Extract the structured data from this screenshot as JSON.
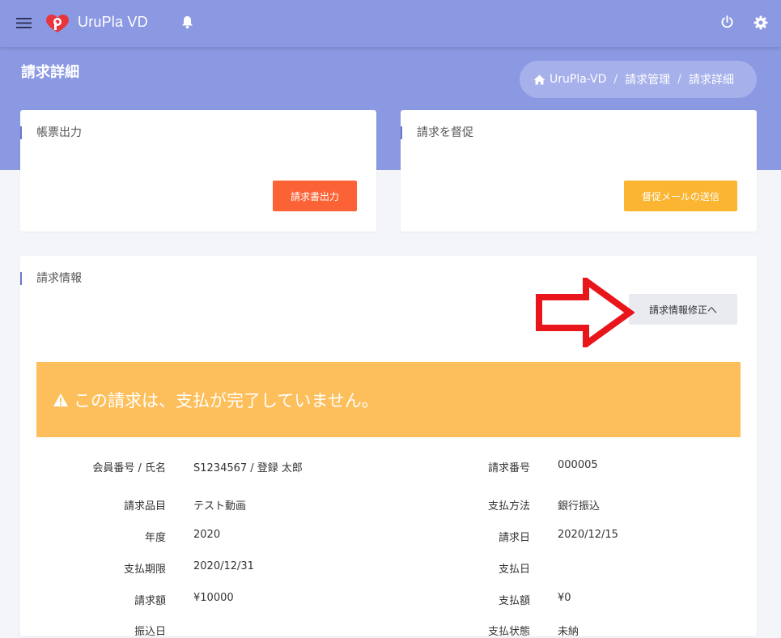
{
  "header": {
    "brand": "UruPla VD",
    "icons": [
      "menu-icon",
      "logo-icon",
      "bell-icon",
      "power-icon",
      "gear-icon"
    ]
  },
  "page": {
    "title": "請求詳細",
    "breadcrumb": [
      "UruPla-VD",
      "請求管理",
      "請求詳細"
    ]
  },
  "cards": {
    "output": {
      "title": "帳票出力",
      "button": "請求書出力"
    },
    "dun": {
      "title": "請求を督促",
      "button": "督促メールの送信"
    },
    "info": {
      "title": "請求情報",
      "edit_button": "請求情報修正へ",
      "alert": "この請求は、支払が完了していません。",
      "rows_left": [
        {
          "label": "会員番号 / 氏名",
          "value": "S1234567 / 登録 太郎"
        },
        {
          "label": "請求品目",
          "value": "テスト動画"
        },
        {
          "label": "年度",
          "value": "2020"
        },
        {
          "label": "支払期限",
          "value": "2020/12/31"
        },
        {
          "label": "請求額",
          "value": "¥10000"
        },
        {
          "label": "振込日",
          "value": ""
        }
      ],
      "rows_right": [
        {
          "label": "請求番号",
          "value": "000005"
        },
        {
          "label": "支払方法",
          "value": "銀行振込"
        },
        {
          "label": "請求日",
          "value": "2020/12/15"
        },
        {
          "label": "支払日",
          "value": ""
        },
        {
          "label": "支払額",
          "value": "¥0"
        },
        {
          "label": "支払状態",
          "value": "未納"
        }
      ]
    }
  },
  "colors": {
    "header": "#8b98e2",
    "invoice_button": "#fb6235",
    "dun_button": "#fbb530",
    "alert": "#fdbf5b",
    "annotation_arrow": "#e8151b"
  }
}
